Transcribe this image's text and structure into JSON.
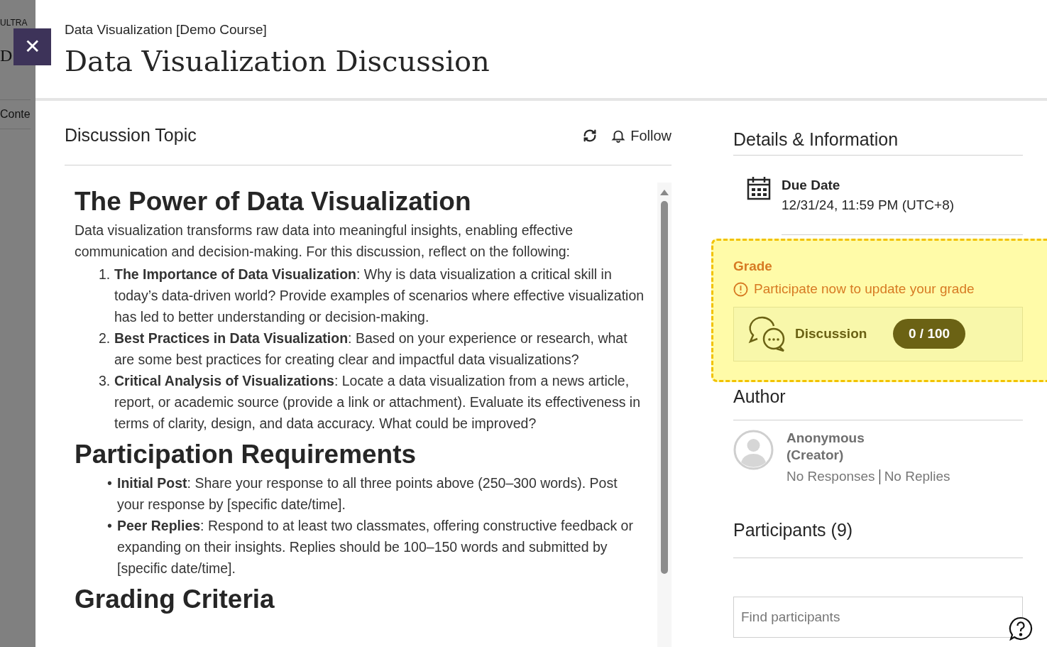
{
  "background": {
    "texts": [
      "ULTRA",
      "D",
      "Conte"
    ]
  },
  "close_button": {
    "label": "✕"
  },
  "header": {
    "breadcrumb": "Data Visualization [Demo Course]",
    "title": "Data Visualization Discussion"
  },
  "topic": {
    "heading": "Discussion Topic",
    "follow": "Follow",
    "content": [
      {
        "kind": "h1",
        "text": "The Power of Data Visualization"
      },
      {
        "kind": "p",
        "text": "Data visualization transforms raw data into meaningful insights, enabling effective communication and decision-making. For this discussion, reflect on the following:"
      },
      {
        "kind": "ol",
        "items": [
          {
            "marker": "1.",
            "text": "**The Importance of Data Visualization**: Why is data visualization a critical skill in today’s data-driven world? Provide examples of scenarios where effective visualization has led to better understanding or decision-making."
          },
          {
            "marker": "2.",
            "text": "**Best Practices in Data Visualization**: Based on your experience or research, what are some best practices for creating clear and impactful data visualizations?"
          },
          {
            "marker": "3.",
            "text": "**Critical Analysis of Visualizations**: Locate a data visualization from a news article, report, or academic source (provide a link or attachment). Evaluate its effectiveness in terms of clarity, design, and data accuracy. What could be improved?"
          }
        ]
      },
      {
        "kind": "h1",
        "text": "Participation Requirements"
      },
      {
        "kind": "ul",
        "items": [
          {
            "marker": "•",
            "text": "**Initial Post**: Share your response to all three points above (250–300 words). Post your response by [specific date/time]."
          },
          {
            "marker": "•",
            "text": "**Peer Replies**: Respond to at least two classmates, offering constructive feedback or expanding on their insights. Replies should be 100–150 words and submitted by [specific date/time]."
          }
        ]
      },
      {
        "kind": "h1",
        "text": "Grading Criteria"
      }
    ]
  },
  "details": {
    "heading": "Details & Information",
    "due_label": "Due Date",
    "due_value": "12/31/24, 11:59 PM (UTC+8)",
    "grade": {
      "label": "Grade",
      "notice": "Participate now to update your grade",
      "item": "Discussion",
      "score": "0 / 100"
    }
  },
  "author": {
    "heading": "Author",
    "name": "Anonymous",
    "role": "(Creator)",
    "responses": "No Responses",
    "replies": "No Replies"
  },
  "participants": {
    "heading": "Participants (9)",
    "search": {
      "placeholder": "Find participants"
    }
  }
}
